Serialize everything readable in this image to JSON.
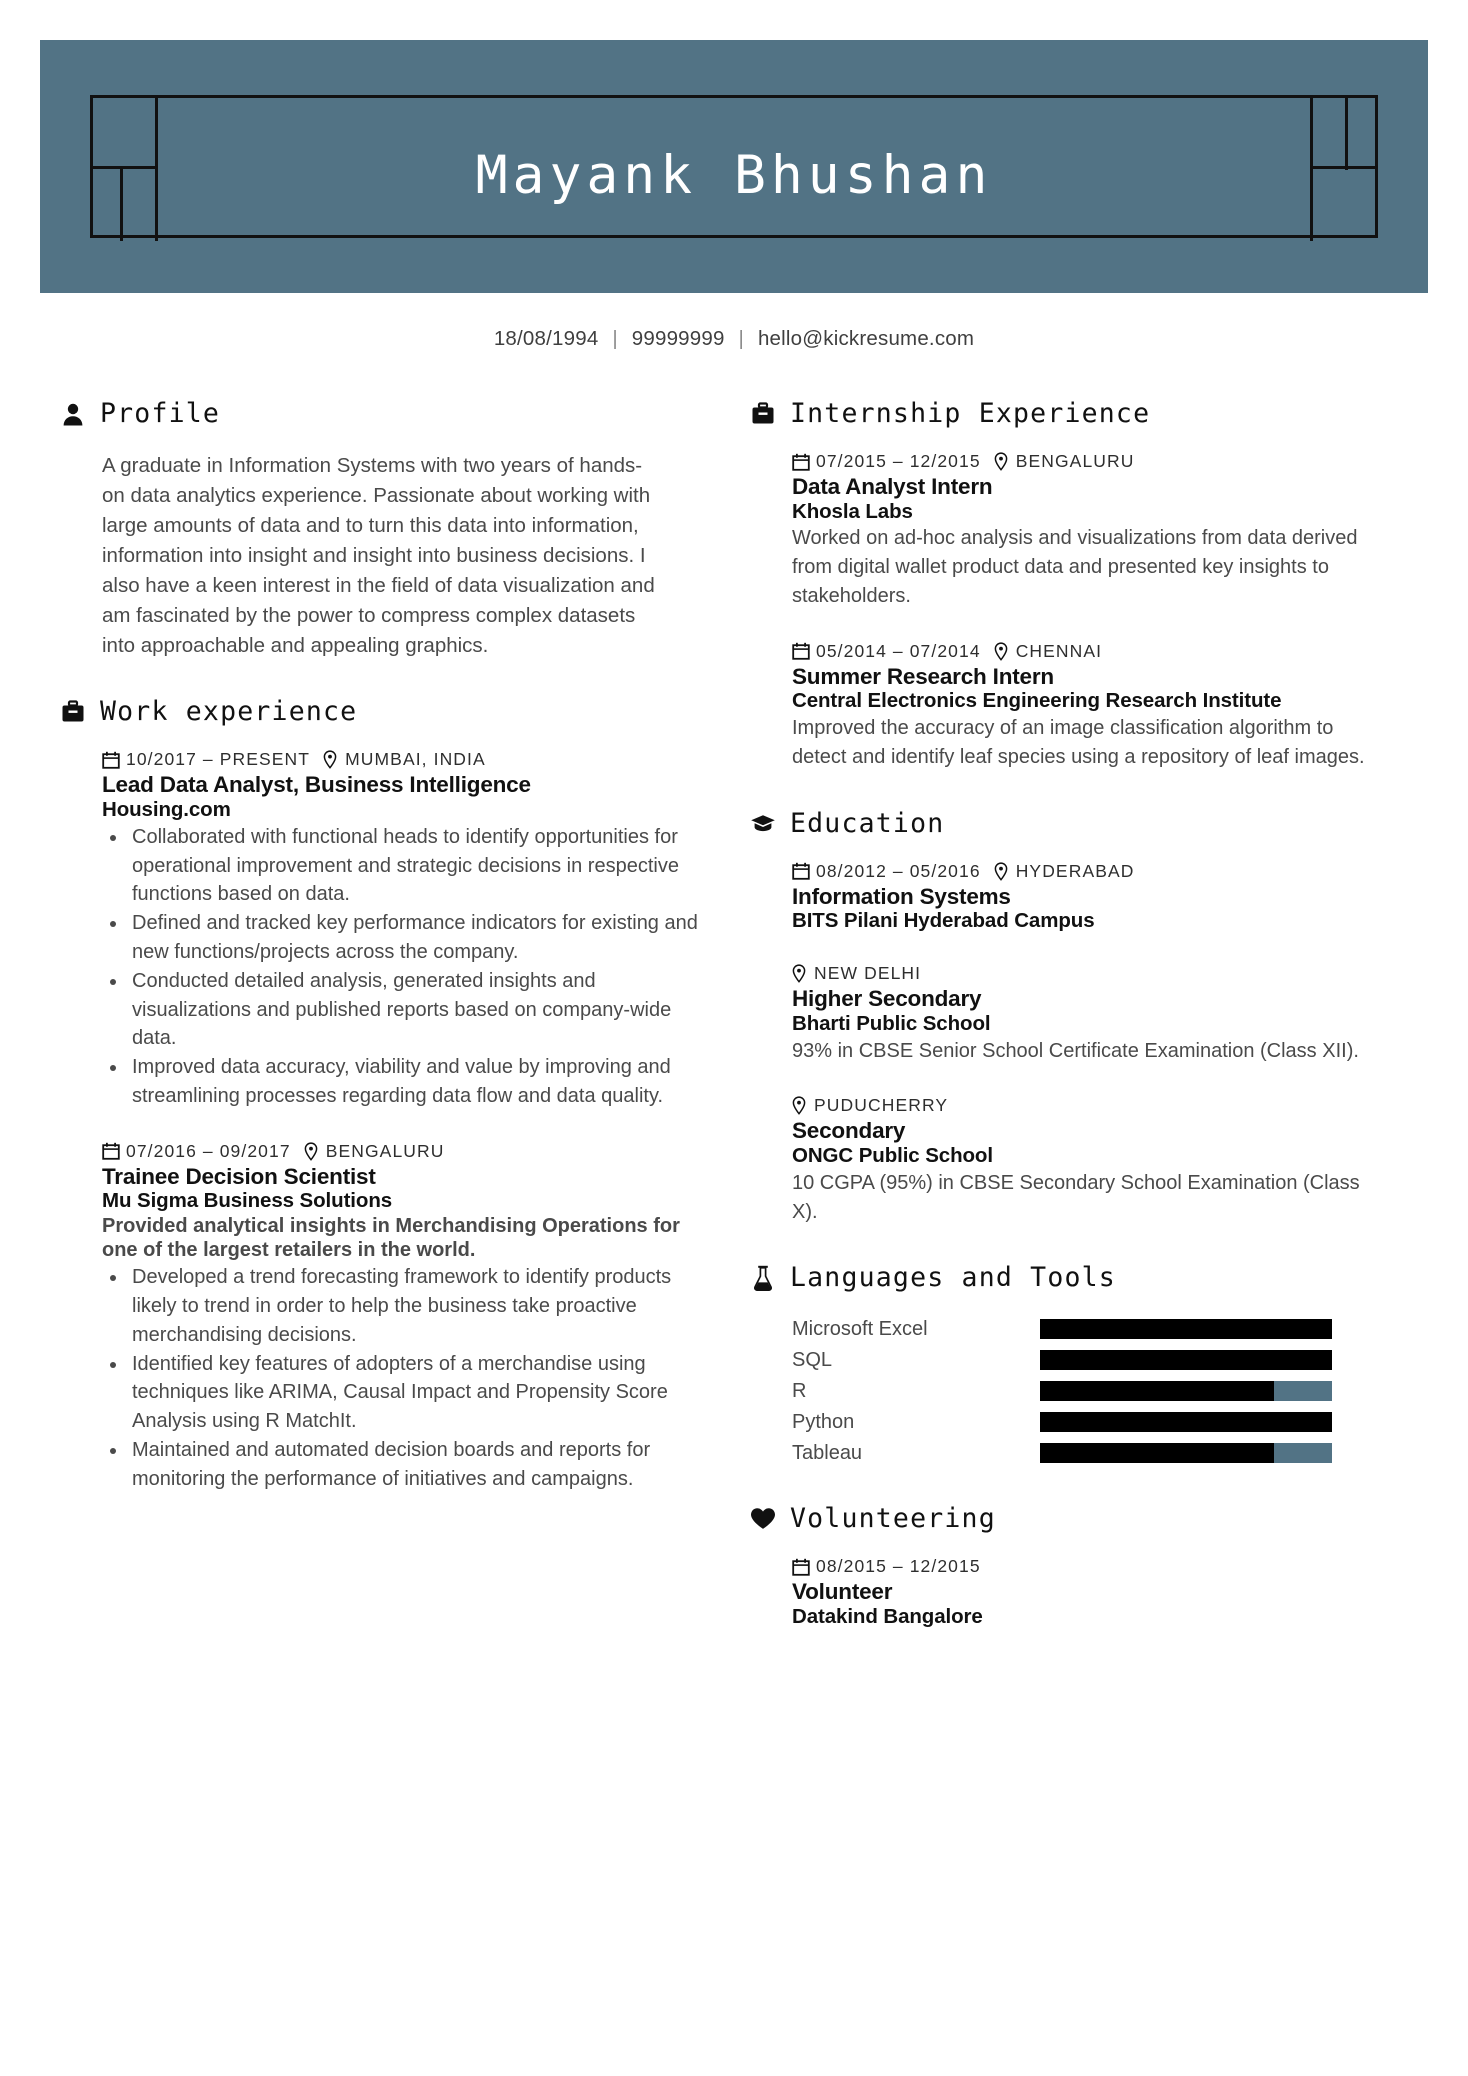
{
  "header": {
    "name": "Mayank Bhushan",
    "accent_color": "#527385",
    "contact": {
      "birthdate": "18/08/1994",
      "phone": "99999999",
      "email": "hello@kickresume.com",
      "separator": "|"
    }
  },
  "sections": {
    "profile": {
      "title": "Profile",
      "icon": "person-icon",
      "text": "A graduate in Information Systems with two years of hands-on data analytics experience. Passionate about working with large amounts of data and to turn this data into information, information into insight and insight into business decisions. I also have a keen interest in the field of data visualization and am fascinated by the power to compress complex datasets into approachable and appealing graphics."
    },
    "work_experience": {
      "title": "Work experience",
      "icon": "briefcase-icon",
      "entries": [
        {
          "date": "10/2017 – PRESENT",
          "location": "MUMBAI, INDIA",
          "role": "Lead Data Analyst, Business Intelligence",
          "org": "Housing.com",
          "lead": "",
          "bullets": [
            "Collaborated with functional heads to identify opportunities for operational improvement and strategic decisions in respective functions based on data.",
            "Defined and tracked key performance indicators for existing and new functions/projects across the company.",
            "Conducted detailed analysis, generated insights and visualizations and published reports based on company-wide data.",
            "Improved data accuracy, viability and value by improving and streamlining processes regarding data flow and data quality."
          ]
        },
        {
          "date": "07/2016 – 09/2017",
          "location": "BENGALURU",
          "role": "Trainee Decision Scientist",
          "org": "Mu Sigma Business Solutions",
          "lead": "Provided analytical insights in Merchandising Operations for one of the largest retailers in the world.",
          "bullets": [
            "Developed a trend forecasting framework to identify products likely to trend in order to help the business take proactive merchandising decisions.",
            "Identified key features of adopters of a merchandise using techniques like ARIMA, Causal Impact and Propensity Score Analysis using R MatchIt.",
            "Maintained and automated decision boards and reports for monitoring the performance of initiatives and campaigns."
          ]
        }
      ]
    },
    "internship_experience": {
      "title": "Internship Experience",
      "icon": "briefcase-icon",
      "entries": [
        {
          "date": "07/2015 – 12/2015",
          "location": "BENGALURU",
          "role": "Data Analyst Intern",
          "org": "Khosla Labs",
          "desc": "Worked on ad-hoc analysis and visualizations from data derived from digital wallet product data and presented key insights to stakeholders."
        },
        {
          "date": "05/2014 – 07/2014",
          "location": "CHENNAI",
          "role": "Summer Research Intern",
          "org": "Central Electronics Engineering Research Institute",
          "desc": "Improved the accuracy of an image classification algorithm to detect and identify leaf species using a repository of leaf images."
        }
      ]
    },
    "education": {
      "title": "Education",
      "icon": "graduation-cap-icon",
      "entries": [
        {
          "date": "08/2012 – 05/2016",
          "location": "HYDERABAD",
          "role": "Information Systems",
          "org": "BITS Pilani Hyderabad Campus",
          "desc": ""
        },
        {
          "date": "",
          "location": "NEW DELHI",
          "role": "Higher Secondary",
          "org": "Bharti Public School",
          "desc": "93% in CBSE Senior School Certificate Examination (Class XII)."
        },
        {
          "date": "",
          "location": "PUDUCHERRY",
          "role": "Secondary",
          "org": "ONGC Public School",
          "desc": "10 CGPA (95%) in CBSE Secondary School Examination (Class X)."
        }
      ]
    },
    "languages_and_tools": {
      "title": "Languages and Tools",
      "icon": "flask-icon",
      "skills": [
        {
          "name": "Microsoft Excel",
          "level": 100
        },
        {
          "name": "SQL",
          "level": 100
        },
        {
          "name": "R",
          "level": 80
        },
        {
          "name": "Python",
          "level": 100
        },
        {
          "name": "Tableau",
          "level": 80
        }
      ],
      "fill_color": "#000000",
      "track_color": "#527385"
    },
    "volunteering": {
      "title": "Volunteering",
      "icon": "heart-icon",
      "entries": [
        {
          "date": "08/2015 – 12/2015",
          "location": "",
          "role": "Volunteer",
          "org": "Datakind Bangalore",
          "desc": ""
        }
      ]
    }
  }
}
